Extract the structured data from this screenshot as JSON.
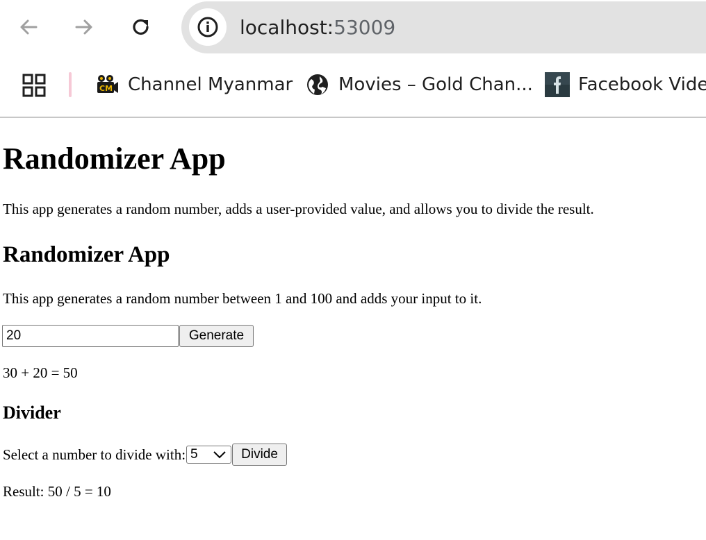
{
  "browser": {
    "url_host": "localhost:",
    "url_port": "53009",
    "bookmarks": [
      {
        "label": "Channel Myanmar",
        "icon": "channel-myanmar-icon"
      },
      {
        "label": "Movies – Gold Chan...",
        "icon": "globe-icon"
      },
      {
        "label": "Facebook Video",
        "icon": "facebook-icon"
      }
    ],
    "colors": {
      "omnibox_bg": "#e2e2e2",
      "bookmark_separator": "#f6c9d6"
    }
  },
  "page": {
    "title": "Randomizer App",
    "intro": "This app generates a random number, adds a user-provided value, and allows you to divide the result.",
    "randomizer": {
      "heading": "Randomizer App",
      "description": "This app generates a random number between 1 and 100 and adds your input to it.",
      "input_value": "20",
      "generate_label": "Generate",
      "sum_text": "30 + 20 = 50"
    },
    "divider": {
      "heading": "Divider",
      "select_label": "Select a number to divide with:",
      "selected_value": "5",
      "divide_label": "Divide",
      "result_text": "Result: 50 / 5 = 10"
    }
  }
}
